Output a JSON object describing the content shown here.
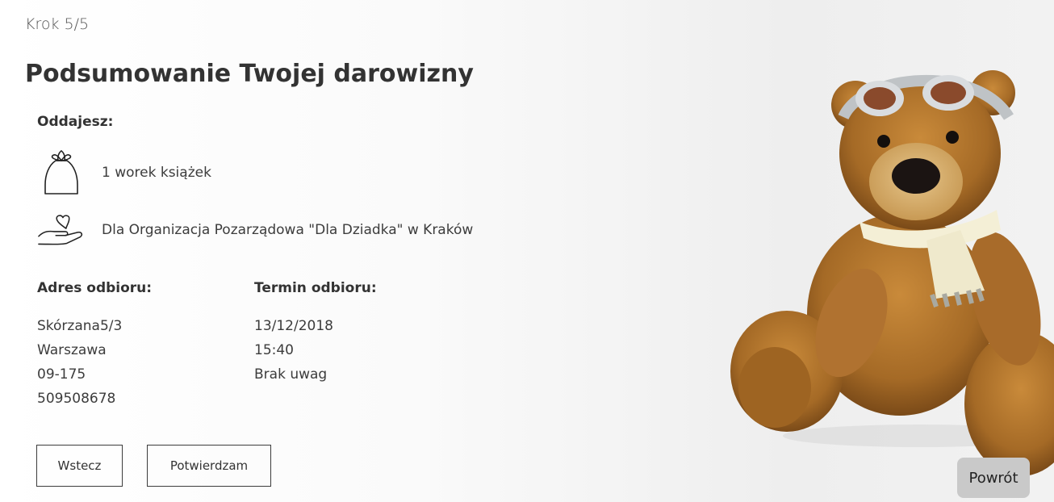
{
  "step": "Krok 5/5",
  "title": "Podsumowanie Twojej darowizny",
  "giving": {
    "label": "Oddajesz:",
    "bag_text": "1 worek książek",
    "bag_icon": "bag-icon",
    "org_text": "Dla Organizacja Pozarządowa \"Dla Dziadka\" w Kraków",
    "org_icon": "heart-hand-icon"
  },
  "address": {
    "label": "Adres odbioru:",
    "street": "Skórzana5/3",
    "city": "Warszawa",
    "postcode": "09-175",
    "phone": "509508678"
  },
  "pickup": {
    "label": "Termin odbioru:",
    "date": "13/12/2018",
    "time": "15:40",
    "notes": "Brak uwag"
  },
  "buttons": {
    "back": "Wstecz",
    "confirm": "Potwierdzam",
    "return": "Powrót"
  }
}
